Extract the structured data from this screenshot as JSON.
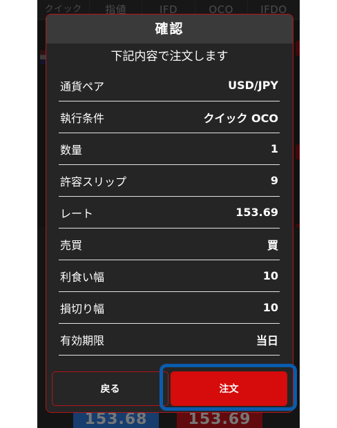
{
  "background": {
    "order_tabs": [
      "クイック",
      "指値",
      "IFD",
      "OCO",
      "IFDO"
    ],
    "bid_price": "153.68",
    "ask_price": "153.69"
  },
  "dialog": {
    "title": "確認",
    "subtitle": "下記内容で注文します",
    "rows": [
      {
        "label": "通貨ペア",
        "value": "USD/JPY"
      },
      {
        "label": "執行条件",
        "value": "クイック OCO"
      },
      {
        "label": "数量",
        "value": "1"
      },
      {
        "label": "許容スリップ",
        "value": "9"
      },
      {
        "label": "レート",
        "value": "153.69"
      },
      {
        "label": "売買",
        "value": "買"
      },
      {
        "label": "利食い幅",
        "value": "10"
      },
      {
        "label": "損切り幅",
        "value": "10"
      },
      {
        "label": "有効期限",
        "value": "当日"
      }
    ],
    "back_label": "戻る",
    "order_label": "注文"
  },
  "colors": {
    "accent_red": "#d60b0b",
    "highlight_blue": "#0b5cad",
    "bid_blue": "#2a6fc9"
  }
}
